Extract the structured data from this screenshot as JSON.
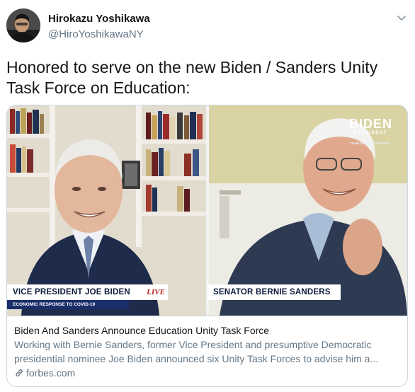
{
  "author": {
    "name": "Hirokazu Yoshikawa",
    "handle": "@HiroYoshikawaNY"
  },
  "tweet": {
    "text": "Honored to serve on the new Biden / Sanders Unity Task Force on Education:"
  },
  "card": {
    "media": {
      "left_caption": "VICE PRESIDENT JOE BIDEN",
      "left_subcaption": "ECONOMIC RESPONSE TO COVID-19",
      "live_label": "LIVE",
      "right_caption": "SENATOR BERNIE SANDERS",
      "logo_main": "BIDEN",
      "logo_sub": "PRESIDENT",
      "logo_tiny": "TEAM UNITED TO DEFEAT"
    },
    "title": "Biden And Sanders Announce Education Unity Task Force",
    "description_line1": "Working with Bernie Sanders, former Vice President and presumptive Democratic",
    "description_line2": "presidential nominee Joe Biden announced six Unity Task Forces to advise him a...",
    "domain": "forbes.com"
  },
  "icons": {
    "menu": "chevron-down-icon",
    "link": "link-icon"
  },
  "colors": {
    "text_primary": "#14171a",
    "text_secondary": "#657786",
    "border": "#ccd6dd",
    "navy": "#1a2f6a",
    "live_red": "#c0201e",
    "campaign_blue": "#3a63c7"
  }
}
